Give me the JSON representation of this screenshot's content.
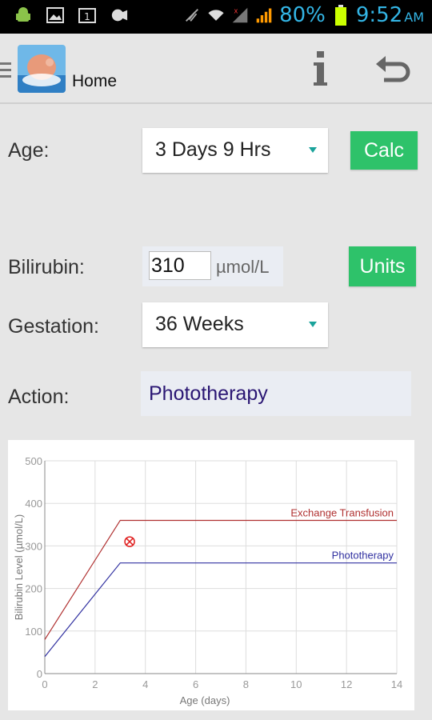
{
  "status_bar": {
    "battery": "80%",
    "time": "9:52",
    "ampm": "AM",
    "icons": [
      "android-icon",
      "image-icon",
      "calendar-icon",
      "voicemail-icon",
      "mute-icon",
      "wifi-icon",
      "signal-icon",
      "signal-icon-2",
      "battery-icon"
    ]
  },
  "header": {
    "title": "Home"
  },
  "form": {
    "age_label": "Age:",
    "age_value": "3 Days 9 Hrs",
    "calc_button": "Calc",
    "bilirubin_label": "Bilirubin:",
    "bilirubin_value": "310",
    "bilirubin_unit": "µmol/L",
    "units_button": "Units",
    "gestation_label": "Gestation:",
    "gestation_value": "36 Weeks",
    "action_label": "Action:",
    "action_value": "Phototherapy"
  },
  "colors": {
    "accent_green": "#2ec26a",
    "exchange_line": "#b03030",
    "photo_line": "#3030a0",
    "action_text": "#2a1673"
  },
  "chart_data": {
    "type": "line",
    "xlabel": "Age (days)",
    "ylabel": "Bilirubin Level (µmol/L)",
    "xlim": [
      0,
      14
    ],
    "ylim": [
      0,
      500
    ],
    "x_ticks": [
      "0",
      "2",
      "4",
      "6",
      "8",
      "10",
      "12",
      "14"
    ],
    "y_ticks": [
      "0",
      "100",
      "200",
      "300",
      "400",
      "500"
    ],
    "grid": true,
    "series": [
      {
        "name": "Exchange Transfusion",
        "x": [
          0,
          3,
          14
        ],
        "y": [
          80,
          360,
          360
        ]
      },
      {
        "name": "Phototherapy",
        "x": [
          0,
          3,
          14
        ],
        "y": [
          40,
          260,
          260
        ]
      }
    ],
    "marker": {
      "x": 3.375,
      "y": 310
    }
  }
}
